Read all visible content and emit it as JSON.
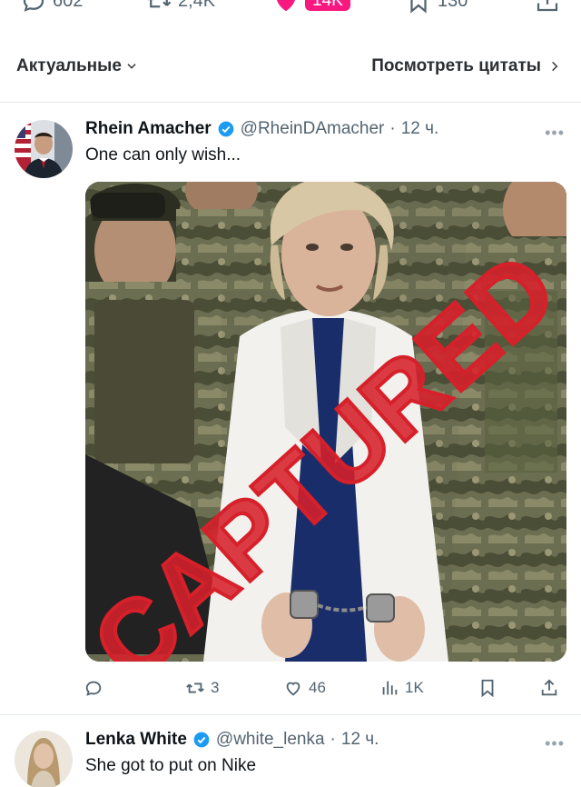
{
  "top_actions": {
    "replies": "602",
    "reposts": "2,4K",
    "likes": "14K",
    "bookmarks": "130"
  },
  "sort": {
    "label": "Актуальные",
    "quotes_link": "Посмотреть цитаты"
  },
  "tweets": [
    {
      "name": "Rhein Amacher",
      "handle": "@RheinDAmacher",
      "time": "12 ч.",
      "text": "One can only wish...",
      "image_stamp": "CAPTURED",
      "actions": {
        "replies": "",
        "reposts": "3",
        "likes": "46",
        "views": "1K"
      }
    },
    {
      "name": "Lenka White",
      "handle": "@white_lenka",
      "time": "12 ч.",
      "text": "She got to put on Nike"
    }
  ],
  "colors": {
    "like_pink": "#f91880",
    "verified_blue": "#1d9bf0",
    "stamp_red": "#d6202a",
    "secondary_text": "#536471"
  },
  "icons": [
    "reply-icon",
    "repost-icon",
    "heart-icon",
    "bookmark-icon",
    "share-icon",
    "views-icon",
    "chevron-down-icon",
    "chevron-right-icon",
    "verified-badge-icon",
    "more-icon"
  ]
}
